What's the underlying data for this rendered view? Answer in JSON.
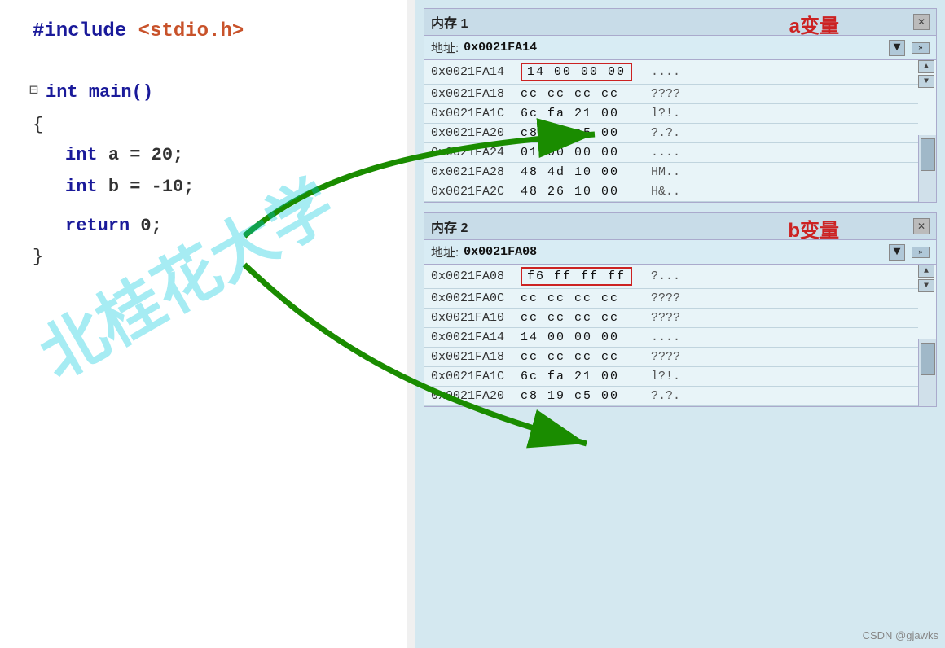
{
  "code": {
    "include_line": "#include <stdio.h>",
    "include_bracket_open": "<",
    "include_file": "stdio.h",
    "include_bracket_close": ">",
    "main_def": "int main()",
    "brace_open": "{",
    "line_a": "int a = 20;",
    "line_b": "int b = -10;",
    "line_return": "return 0;",
    "brace_close": "}"
  },
  "memory1": {
    "title": "内存 1",
    "address_label": "地址:",
    "address_value": "0x0021FA14",
    "annotation": "a变量",
    "rows": [
      {
        "addr": "0x0021FA14",
        "hex": "14 00 00 00",
        "ascii": "....",
        "highlighted": true
      },
      {
        "addr": "0x0021FA18",
        "hex": "cc cc cc cc",
        "ascii": "????",
        "highlighted": false
      },
      {
        "addr": "0x0021FA1C",
        "hex": "6c fa 21 00",
        "ascii": "l?!.",
        "highlighted": false
      },
      {
        "addr": "0x0021FA20",
        "hex": "c8 19 c5 00",
        "ascii": "?.?.",
        "highlighted": false
      },
      {
        "addr": "0x0021FA24",
        "hex": "01 00 00 00",
        "ascii": "....",
        "highlighted": false
      },
      {
        "addr": "0x0021FA28",
        "hex": "48 4d 10 00",
        "ascii": "HM..",
        "highlighted": false
      },
      {
        "addr": "0x0021FA2C",
        "hex": "48 26 10 00",
        "ascii": "H&..",
        "highlighted": false
      }
    ]
  },
  "memory2": {
    "title": "内存 2",
    "address_label": "地址:",
    "address_value": "0x0021FA08",
    "annotation": "b变量",
    "rows": [
      {
        "addr": "0x0021FA08",
        "hex": "f6 ff ff ff",
        "ascii": "?...",
        "highlighted": true
      },
      {
        "addr": "0x0021FA0C",
        "hex": "cc cc cc cc",
        "ascii": "????",
        "highlighted": false
      },
      {
        "addr": "0x0021FA10",
        "hex": "cc cc cc cc",
        "ascii": "????",
        "highlighted": false
      },
      {
        "addr": "0x0021FA14",
        "hex": "14 00 00 00",
        "ascii": "....",
        "highlighted": false
      },
      {
        "addr": "0x0021FA18",
        "hex": "cc cc cc cc",
        "ascii": "????",
        "highlighted": false
      },
      {
        "addr": "0x0021FA1C",
        "hex": "6c fa 21 00",
        "ascii": "l?!.",
        "highlighted": false
      },
      {
        "addr": "0x0021FA20",
        "hex": "c8 19 c5 00",
        "ascii": "?.?.",
        "highlighted": false
      }
    ]
  },
  "watermark_text": "北桂花大学",
  "csdn_label": "CSDN @gjawks"
}
